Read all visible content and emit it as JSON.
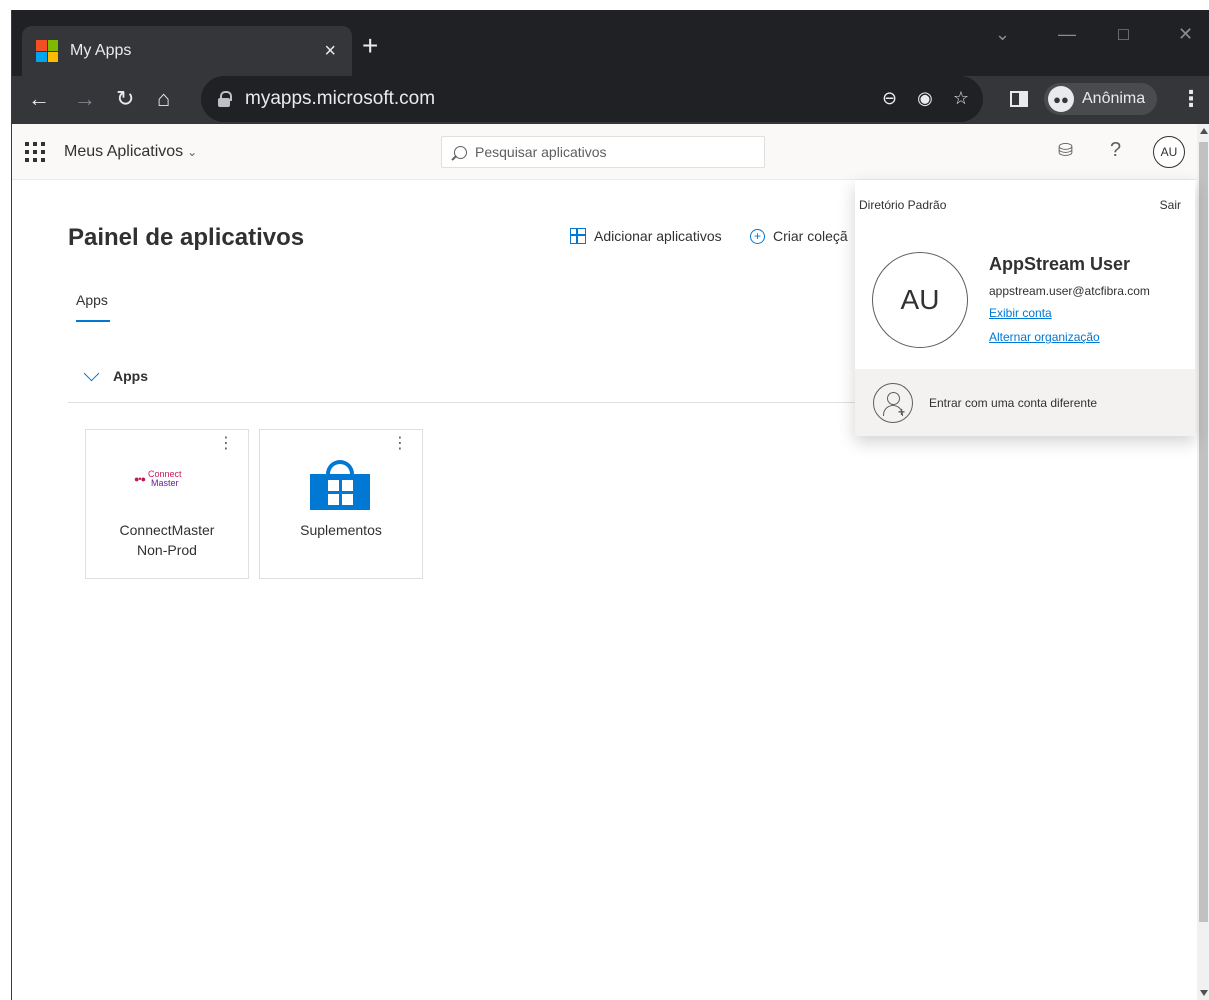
{
  "browser": {
    "tab_title": "My Apps",
    "tab_close": "×",
    "new_tab": "+",
    "url": "myapps.microsoft.com",
    "profile_label": "Anônima",
    "controls": [
      "minimize",
      "maximize",
      "close"
    ]
  },
  "header": {
    "brand": "Meus Aplicativos",
    "search_placeholder": "Pesquisar aplicativos",
    "avatar_initials": "AU"
  },
  "main": {
    "title": "Painel de aplicativos",
    "add_apps": "Adicionar aplicativos",
    "create_collection": "Criar coleçã",
    "tabs": [
      {
        "label": "Apps"
      }
    ],
    "section_label": "Apps",
    "apps": [
      {
        "name": "ConnectMaster\nNon-Prod",
        "logo_top": "Connect",
        "logo_bottom": "Master"
      },
      {
        "name": "Suplementos"
      }
    ]
  },
  "account": {
    "directory": "Diretório Padrão",
    "sign_out": "Sair",
    "initials": "AU",
    "name": "AppStream User",
    "email": "appstream.user@atcfibra.com",
    "view_account": "Exibir conta",
    "switch_org": "Alternar organização",
    "sign_in_other": "Entrar com uma conta diferente"
  },
  "colors": {
    "accent": "#0078d4",
    "chrome_dark": "#202124",
    "chrome_toolbar": "#35363a"
  }
}
